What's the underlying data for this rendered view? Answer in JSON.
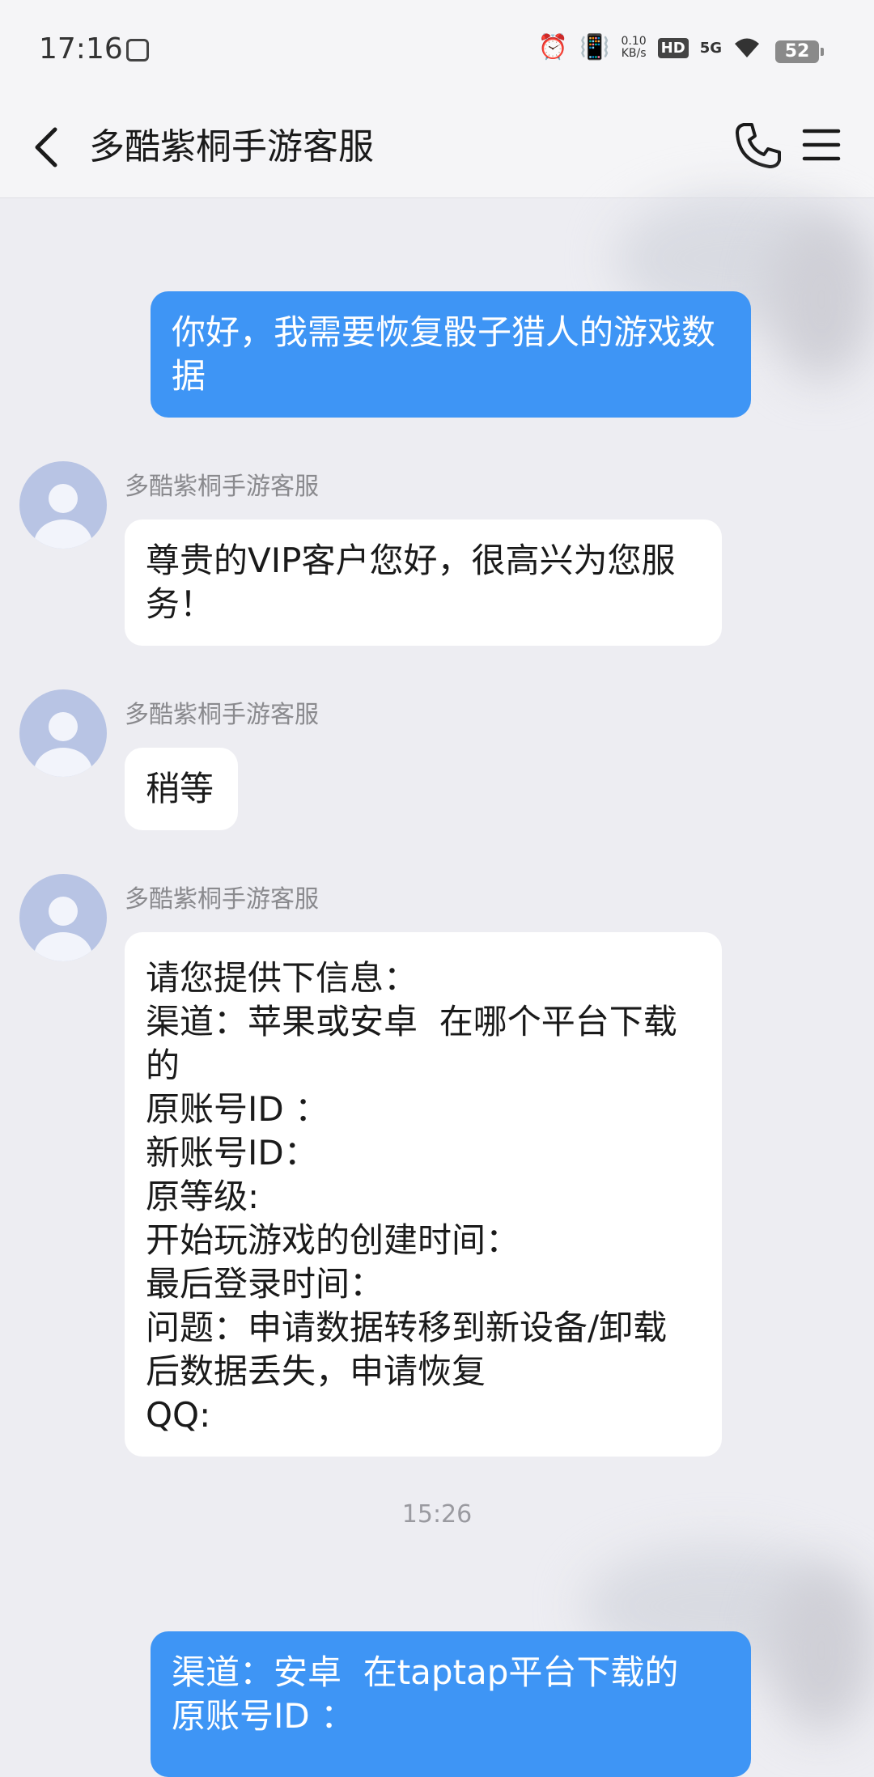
{
  "status_bar": {
    "time": "17:16",
    "net_speed_value": "0.10",
    "net_speed_unit": "KB/s",
    "hd": "HD",
    "signal": "5G",
    "battery": "52"
  },
  "header": {
    "title": "多酷紫桐手游客服"
  },
  "messages": [
    {
      "direction": "out",
      "text": "你好，我需要恢复骰子猎人的游戏数据"
    },
    {
      "direction": "in",
      "sender": "多酷紫桐手游客服",
      "text": "尊贵的VIP客户您好，很高兴为您服务！"
    },
    {
      "direction": "in",
      "sender": "多酷紫桐手游客服",
      "text": "稍等"
    },
    {
      "direction": "in",
      "sender": "多酷紫桐手游客服",
      "text": "请您提供下信息：\n渠道：苹果或安卓  在哪个平台下载的\n原账号ID ：\n新账号ID：\n原等级:\n开始玩游戏的创建时间：\n最后登录时间：\n问题：申请数据转移到新设备/卸载后数据丢失，申请恢复\nQQ:"
    },
    {
      "direction": "out",
      "text": "渠道：安卓  在taptap平台下载的\n原账号ID ："
    }
  ],
  "timestamp": "15:26",
  "colors": {
    "outgoing_bubble": "#3e95f5",
    "incoming_bubble": "#ffffff",
    "background": "#ededf2"
  },
  "icons": [
    "back-icon",
    "phone-icon",
    "menu-icon",
    "alarm-icon",
    "vibrate-icon",
    "wifi-icon",
    "battery-icon",
    "sim-icon"
  ]
}
